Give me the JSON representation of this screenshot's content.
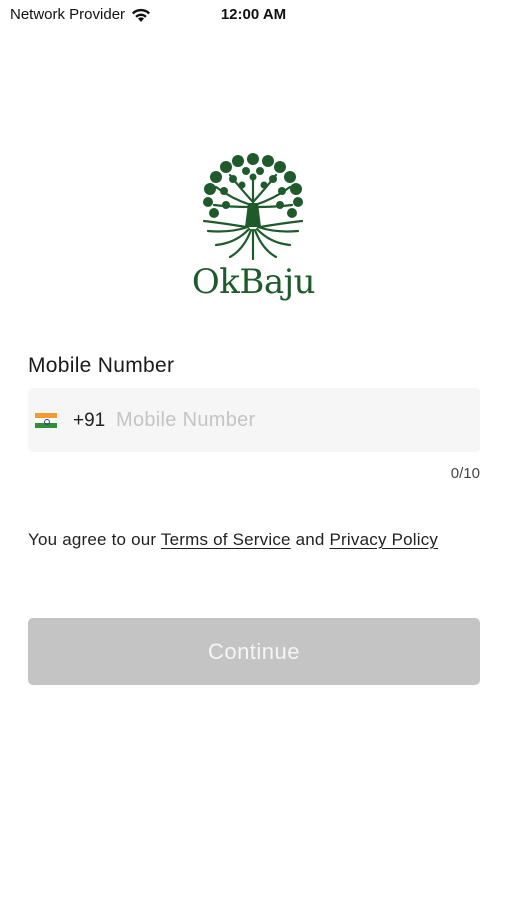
{
  "status_bar": {
    "carrier": "Network Provider",
    "time": "12:00 AM",
    "wifi_icon": "wifi-icon"
  },
  "brand": {
    "name": "OkBaju",
    "logo_icon": "tree-logo-icon",
    "color": "#1f5a2c"
  },
  "form": {
    "label": "Mobile Number",
    "flag_icon": "india-flag-icon",
    "dial_code": "+91",
    "phone_placeholder": "Mobile Number",
    "phone_value": "",
    "counter": "0/10"
  },
  "agreement": {
    "prefix": "You agree to our ",
    "terms": "Terms of Service",
    "middle": " and ",
    "privacy": "Privacy Policy"
  },
  "continue": {
    "label": "Continue",
    "background": "#c4c4c4"
  }
}
